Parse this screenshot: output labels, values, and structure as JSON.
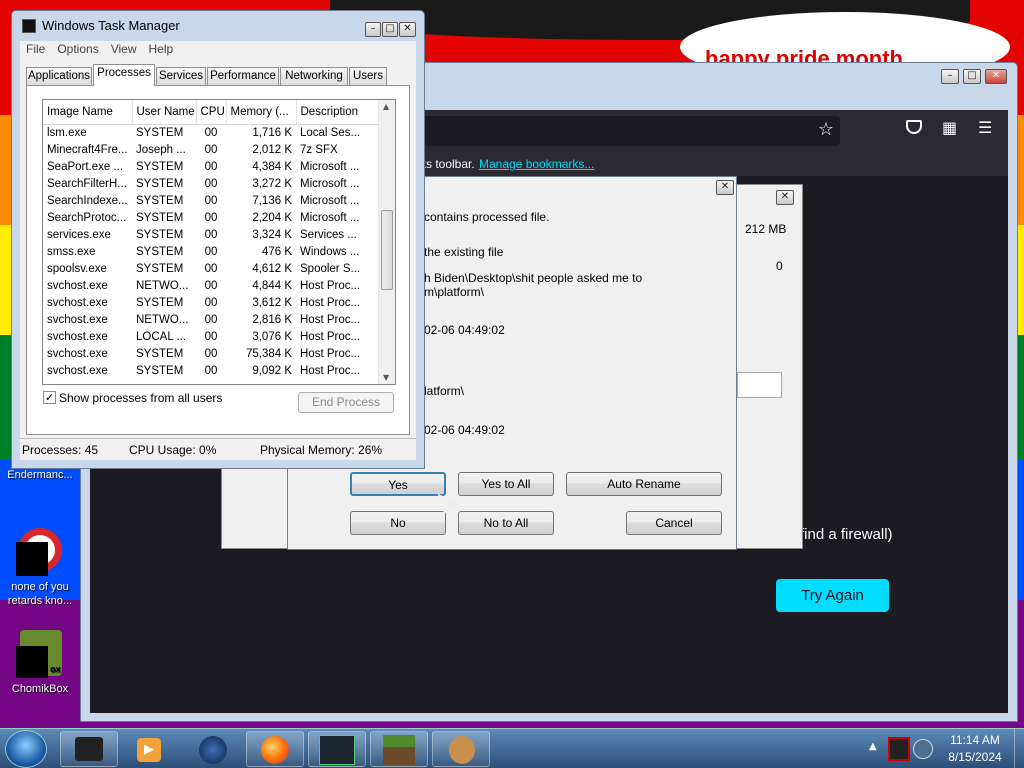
{
  "wallpaper": {
    "banner_text": "happy pride month",
    "stripe_colors": [
      "#e40303",
      "#ff8c00",
      "#ffed00",
      "#008026",
      "#004dff",
      "#750787"
    ]
  },
  "desktop_icons": [
    {
      "label": "Endermanc...",
      "icon": "game-icon"
    },
    {
      "label": "none of you retards kno...",
      "icon": "opera-icon"
    },
    {
      "label": "ChomikBox",
      "icon": "hamster-icon"
    }
  ],
  "task_manager": {
    "title": "Windows Task Manager",
    "menu": [
      "File",
      "Options",
      "View",
      "Help"
    ],
    "tabs": [
      "Applications",
      "Processes",
      "Services",
      "Performance",
      "Networking",
      "Users"
    ],
    "active_tab": "Processes",
    "columns": [
      "Image Name",
      "User Name",
      "CPU",
      "Memory (...",
      "Description"
    ],
    "processes": [
      [
        "lsm.exe",
        "SYSTEM",
        "00",
        "1,716 K",
        "Local Ses..."
      ],
      [
        "Minecraft4Fre...",
        "Joseph ...",
        "00",
        "2,012 K",
        "7z SFX"
      ],
      [
        "SeaPort.exe ...",
        "SYSTEM",
        "00",
        "4,384 K",
        "Microsoft ..."
      ],
      [
        "SearchFilterH...",
        "SYSTEM",
        "00",
        "3,272 K",
        "Microsoft ..."
      ],
      [
        "SearchIndexe...",
        "SYSTEM",
        "00",
        "7,136 K",
        "Microsoft ..."
      ],
      [
        "SearchProtoc...",
        "SYSTEM",
        "00",
        "2,204 K",
        "Microsoft ..."
      ],
      [
        "services.exe",
        "SYSTEM",
        "00",
        "3,324 K",
        "Services ..."
      ],
      [
        "smss.exe",
        "SYSTEM",
        "00",
        "476 K",
        "Windows ..."
      ],
      [
        "spoolsv.exe",
        "SYSTEM",
        "00",
        "4,612 K",
        "Spooler S..."
      ],
      [
        "svchost.exe",
        "NETWO...",
        "00",
        "4,844 K",
        "Host Proc..."
      ],
      [
        "svchost.exe",
        "SYSTEM",
        "00",
        "3,612 K",
        "Host Proc..."
      ],
      [
        "svchost.exe",
        "NETWO...",
        "00",
        "2,816 K",
        "Host Proc..."
      ],
      [
        "svchost.exe",
        "LOCAL ...",
        "00",
        "3,076 K",
        "Host Proc..."
      ],
      [
        "svchost.exe",
        "SYSTEM",
        "00",
        "75,384 K",
        "Host Proc..."
      ],
      [
        "svchost.exe",
        "SYSTEM",
        "00",
        "9,092 K",
        "Host Proc..."
      ]
    ],
    "show_all_label": "Show processes from all users",
    "show_all_checked": true,
    "end_process_label": "End Process",
    "status": {
      "processes": "Processes: 45",
      "cpu": "CPU Usage: 0%",
      "memory": "Physical Memory: 26%"
    }
  },
  "firefox": {
    "bookmarks_text": "ks toolbar.",
    "manage_bookmarks": "Manage bookmarks...",
    "page_text": "find a firewall)",
    "try_again": "Try Again"
  },
  "background_dialog": {
    "size_value": "212 MB",
    "count_value": "0"
  },
  "confirm_dialog": {
    "line1": "contains processed file.",
    "line2": "the existing file",
    "path1": "h Biden\\Desktop\\shit people asked me to",
    "path2": "m\\platform\\",
    "date1": "02-06 04:49:02",
    "path3": "latform\\",
    "date2": "02-06 04:49:02",
    "buttons": {
      "yes": "Yes",
      "yes_all": "Yes to All",
      "auto_rename": "Auto Rename",
      "no": "No",
      "no_all": "No to All",
      "cancel": "Cancel"
    }
  },
  "taskbar": {
    "items": [
      "terminal-icon",
      "media-player-icon",
      "globe-icon",
      "firefox-icon",
      "game-icon",
      "minecraft-icon",
      "hamster-icon"
    ],
    "time": "11:14 AM",
    "date": "8/15/2024"
  }
}
